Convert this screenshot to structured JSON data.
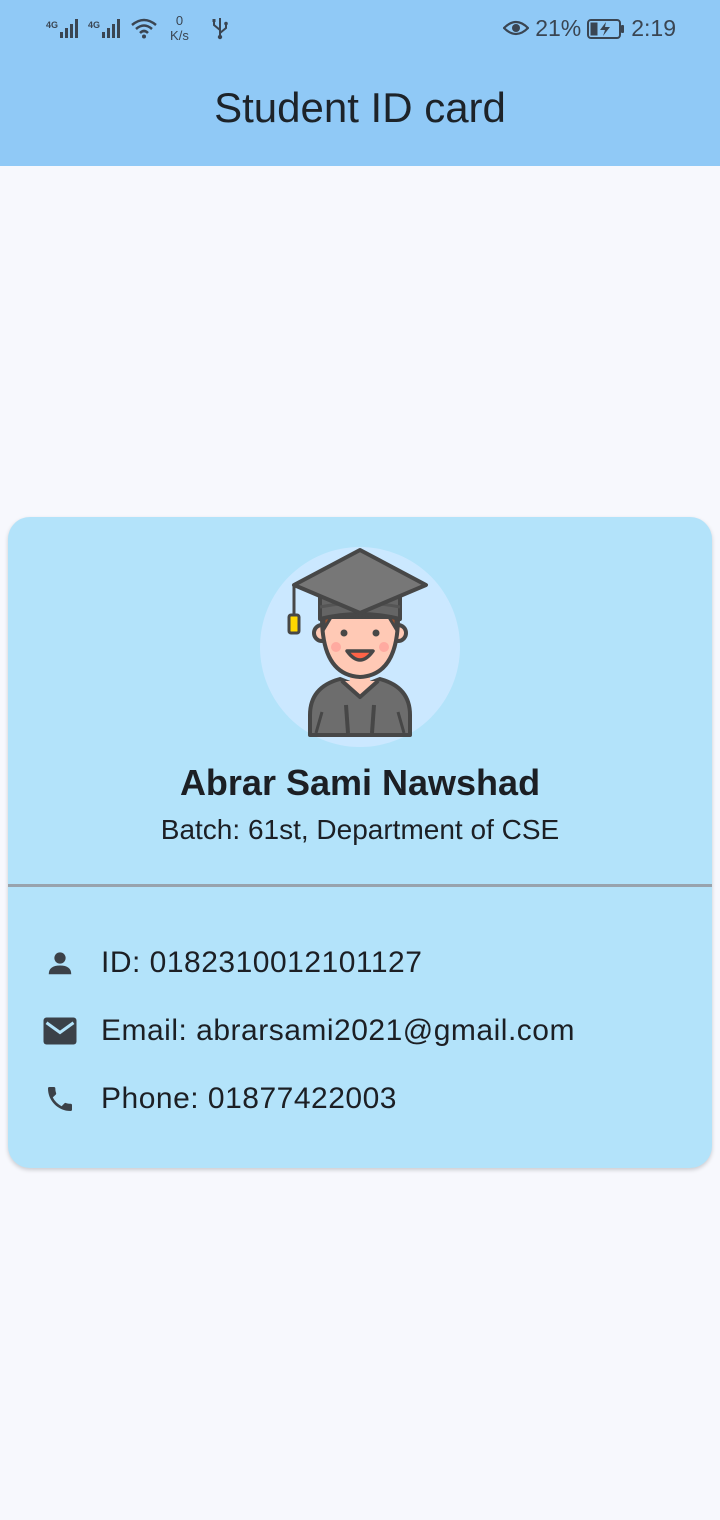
{
  "status_bar": {
    "network_1": "4G",
    "network_2": "4G",
    "speed_value": "0",
    "speed_unit": "K/s",
    "battery_percent": "21%",
    "time": "2:19"
  },
  "app_bar": {
    "title": "Student ID card"
  },
  "card": {
    "name": "Abrar Sami Nawshad",
    "batch": "Batch: 61st, Department of CSE",
    "id_text": "ID: 0182310012101127",
    "email_text": "Email: abrarsami2021@gmail.com",
    "phone_text": "Phone: 01877422003"
  },
  "icons": {
    "avatar": "graduate-avatar-icon",
    "id": "person-icon",
    "email": "mail-icon",
    "phone": "phone-icon"
  },
  "colors": {
    "app_bar": "#90c9f6",
    "background": "#f7f8fd",
    "card": "#b3e3fa",
    "divider": "#98a3ad",
    "icon": "#3b4148"
  }
}
